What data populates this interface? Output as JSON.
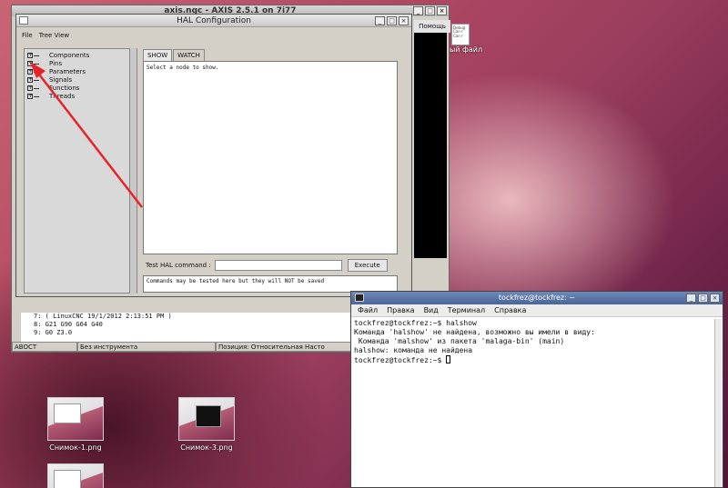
{
  "desktop": {
    "icons": [
      {
        "label": "Снимок-1.png"
      },
      {
        "label": "Снимок-3.png"
      },
      {
        "label": ""
      }
    ],
    "file_label": "ый файл",
    "file_lines": [
      "Debug",
      "Can r",
      "Can r"
    ]
  },
  "axis_window": {
    "title": "axis.ngc - AXIS 2.5.1 on 7i77",
    "help_label": "Помощь",
    "gcode_lines": [
      "7:  ( LinuxCNC 19/1/2012 2:13:51 PM )",
      "8:  G21 G90 G64 G40",
      "9:  G0 Z3.0"
    ],
    "status": [
      "ABOCT",
      "Без инструмента",
      "Позиция: Относительная Насто"
    ]
  },
  "hal_window": {
    "title": "HAL Configuration",
    "menu": [
      "File",
      "Tree View"
    ],
    "tree_items": [
      "Components",
      "Pins",
      "Parameters",
      "Signals",
      "Functions",
      "Threads"
    ],
    "tabs": [
      "SHOW",
      "WATCH"
    ],
    "show_text": "Select a node to show.",
    "cmd_label": "Test HAL command :",
    "cmd_value": "",
    "execute_label": "Execute",
    "output_text": "Commands may be tested here but they will NOT be saved"
  },
  "terminal": {
    "title": "tockfrez@tockfrez: ~",
    "menu": [
      "Файл",
      "Правка",
      "Вид",
      "Терминал",
      "Справка"
    ],
    "lines": [
      "tockfrez@tockfrez:~$ halshow",
      "Команда 'halshow' не найдена, возможно вы имели в виду:",
      " Команда 'malshow' из пакета 'malaga-bin' (main)",
      "halshow: команда не найдена"
    ],
    "prompt": "tockfrez@tockfrez:~$ "
  },
  "colors": {
    "annotation_arrow": "#e8222a"
  }
}
